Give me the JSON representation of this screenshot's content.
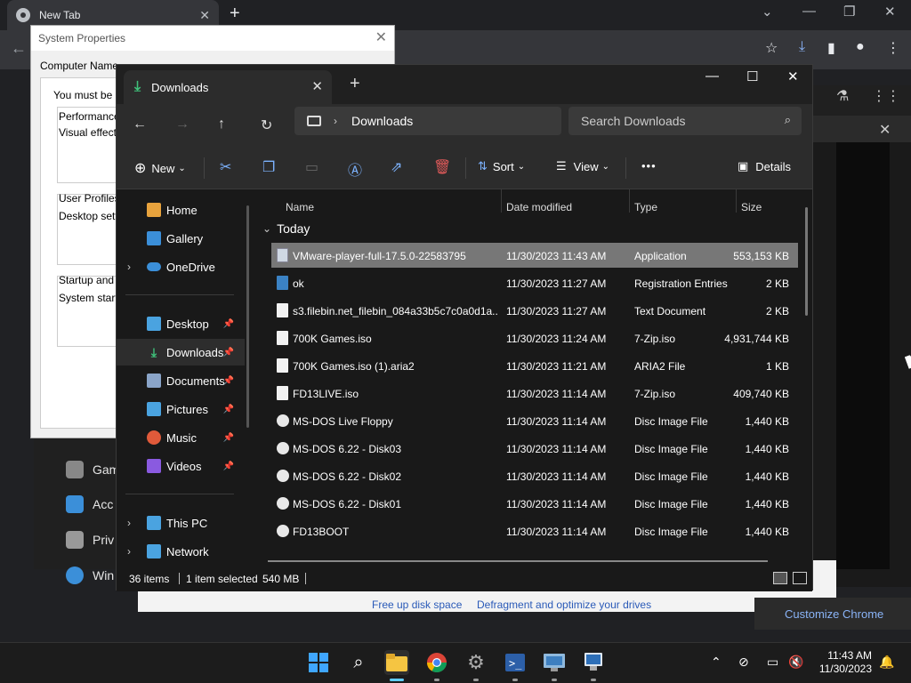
{
  "chrome": {
    "tab_title": "New Tab",
    "customize_label": "Customize Chrome"
  },
  "settings_side": {
    "items": [
      "Gam",
      "Acc",
      "Priv",
      "Win"
    ]
  },
  "disk_tools": {
    "link1": "Free up disk space",
    "link2": "Defragment and optimize your drives"
  },
  "sysprop": {
    "title": "System Properties",
    "tab": "Computer Name",
    "text_admin": "You must be lo",
    "perf_label": "Performance",
    "perf_desc": "Visual effects,",
    "profiles_label": "User Profiles",
    "profiles_desc": "Desktop setti",
    "startup_label": "Startup and R",
    "startup_desc": "System startup"
  },
  "explorer": {
    "tab_title": "Downloads",
    "address": "Downloads",
    "search_placeholder": "Search Downloads",
    "cmd": {
      "new": "New",
      "sort": "Sort",
      "view": "View",
      "more": "•••",
      "details": "Details"
    },
    "nav": [
      {
        "label": "Home",
        "icon": "home-icon",
        "color": "#e8a33d"
      },
      {
        "label": "Gallery",
        "icon": "gallery-icon",
        "color": "#3b8fd9"
      },
      {
        "label": "OneDrive",
        "icon": "onedrive-icon",
        "color": "#3b8fd9"
      },
      {
        "label": "Desktop",
        "icon": "desktop-icon",
        "color": "#4aa3e0"
      },
      {
        "label": "Downloads",
        "icon": "downloads-icon",
        "color": "#3fc17a"
      },
      {
        "label": "Documents",
        "icon": "documents-icon",
        "color": "#8aa4c8"
      },
      {
        "label": "Pictures",
        "icon": "pictures-icon",
        "color": "#4aa3e0"
      },
      {
        "label": "Music",
        "icon": "music-icon",
        "color": "#e05a3a"
      },
      {
        "label": "Videos",
        "icon": "videos-icon",
        "color": "#8a5ae0"
      },
      {
        "label": "This PC",
        "icon": "this-pc-icon",
        "color": "#4aa3e0"
      },
      {
        "label": "Network",
        "icon": "network-icon",
        "color": "#4aa3e0"
      }
    ],
    "columns": {
      "name": "Name",
      "date": "Date modified",
      "type": "Type",
      "size": "Size"
    },
    "group": "Today",
    "files": [
      {
        "name": "VMware-player-full-17.5.0-22583795",
        "date": "11/30/2023 11:43 AM",
        "type": "Application",
        "size": "553,153 KB",
        "icon": "app"
      },
      {
        "name": "ok",
        "date": "11/30/2023 11:27 AM",
        "type": "Registration Entries",
        "size": "2 KB",
        "icon": "reg"
      },
      {
        "name": "s3.filebin.net_filebin_084a33b5c7c0a0d1a...",
        "date": "11/30/2023 11:27 AM",
        "type": "Text Document",
        "size": "2 KB",
        "icon": "doc"
      },
      {
        "name": "700K Games.iso",
        "date": "11/30/2023 11:24 AM",
        "type": "7-Zip.iso",
        "size": "4,931,744 KB",
        "icon": "doc"
      },
      {
        "name": "700K Games.iso (1).aria2",
        "date": "11/30/2023 11:21 AM",
        "type": "ARIA2 File",
        "size": "1 KB",
        "icon": "doc"
      },
      {
        "name": "FD13LIVE.iso",
        "date": "11/30/2023 11:14 AM",
        "type": "7-Zip.iso",
        "size": "409,740 KB",
        "icon": "doc"
      },
      {
        "name": "MS-DOS Live Floppy",
        "date": "11/30/2023 11:14 AM",
        "type": "Disc Image File",
        "size": "1,440 KB",
        "icon": "disc"
      },
      {
        "name": "MS-DOS 6.22 - Disk03",
        "date": "11/30/2023 11:14 AM",
        "type": "Disc Image File",
        "size": "1,440 KB",
        "icon": "disc"
      },
      {
        "name": "MS-DOS 6.22 - Disk02",
        "date": "11/30/2023 11:14 AM",
        "type": "Disc Image File",
        "size": "1,440 KB",
        "icon": "disc"
      },
      {
        "name": "MS-DOS 6.22 - Disk01",
        "date": "11/30/2023 11:14 AM",
        "type": "Disc Image File",
        "size": "1,440 KB",
        "icon": "disc"
      },
      {
        "name": "FD13BOOT",
        "date": "11/30/2023 11:14 AM",
        "type": "Disc Image File",
        "size": "1,440 KB",
        "icon": "disc"
      }
    ],
    "status": {
      "count": "36 items",
      "selected": "1 item selected",
      "size": "540 MB"
    }
  },
  "taskbar": {
    "time": "11:43 AM",
    "date": "11/30/2023"
  }
}
